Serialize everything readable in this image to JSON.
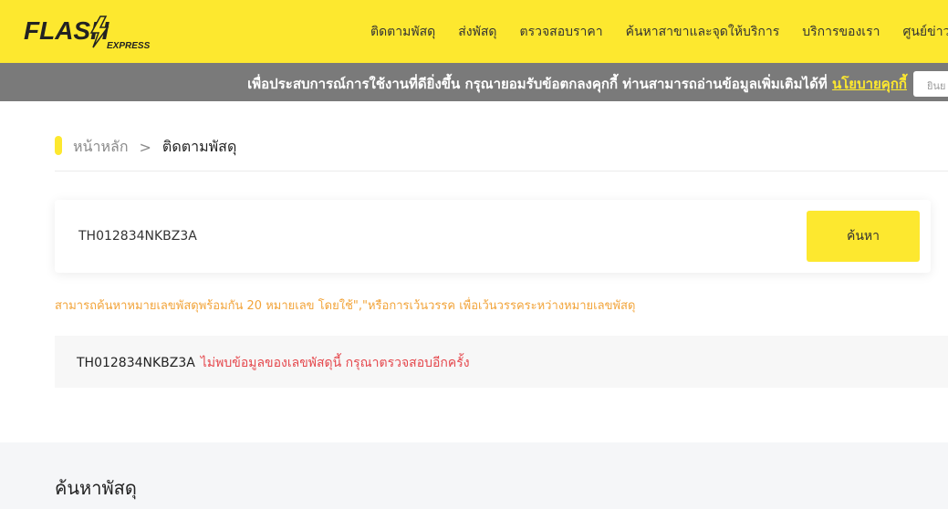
{
  "brand": {
    "logo_text": "FLASH",
    "logo_sub": "EXPRESS",
    "colors": {
      "primary": "#fde82f",
      "dark": "#222222",
      "muted": "#7a7a7a",
      "hint": "#f2a43a",
      "error": "#e5484d"
    }
  },
  "nav": {
    "items": [
      {
        "label": "ติดตามพัสดุ"
      },
      {
        "label": "ส่งพัสดุ"
      },
      {
        "label": "ตรวจสอบราคา"
      },
      {
        "label": "ค้นหาสาขาและจุดให้บริการ"
      },
      {
        "label": "บริการของเรา"
      },
      {
        "label": "ศูนย์ข่าวประช"
      }
    ]
  },
  "cookie": {
    "text": "เพื่อประสบการณ์การใช้งานที่ดียิ่งขึ้น กรุณายอมรับข้อตกลงคุกกี้ ท่านสามารถอ่านข้อมูลเพิ่มเติมได้ที่",
    "link": "นโยบายคุกกี้",
    "accept_label": "ยินย"
  },
  "breadcrumb": {
    "home": "หน้าหลัก",
    "separator": ">",
    "current": "ติดตามพัสดุ"
  },
  "search": {
    "value": "TH012834NKBZ3A",
    "button_label": "ค้นหา",
    "hint": "สามารถค้นหาหมายเลขพัสดุพร้อมกัน 20 หมายเลข โดยใช้\",\"หรือการเว้นวรรค เพื่อเว้นวรรคระหว่างหมายเลขพัสดุ"
  },
  "result": {
    "tracking_number": "TH012834NKBZ3A",
    "error": "ไม่พบข้อมูลของเลขพัสดุนี้ กรุณาตรวจสอบอีกครั้ง"
  },
  "bottom": {
    "title": "ค้นหาพัสดุ"
  }
}
